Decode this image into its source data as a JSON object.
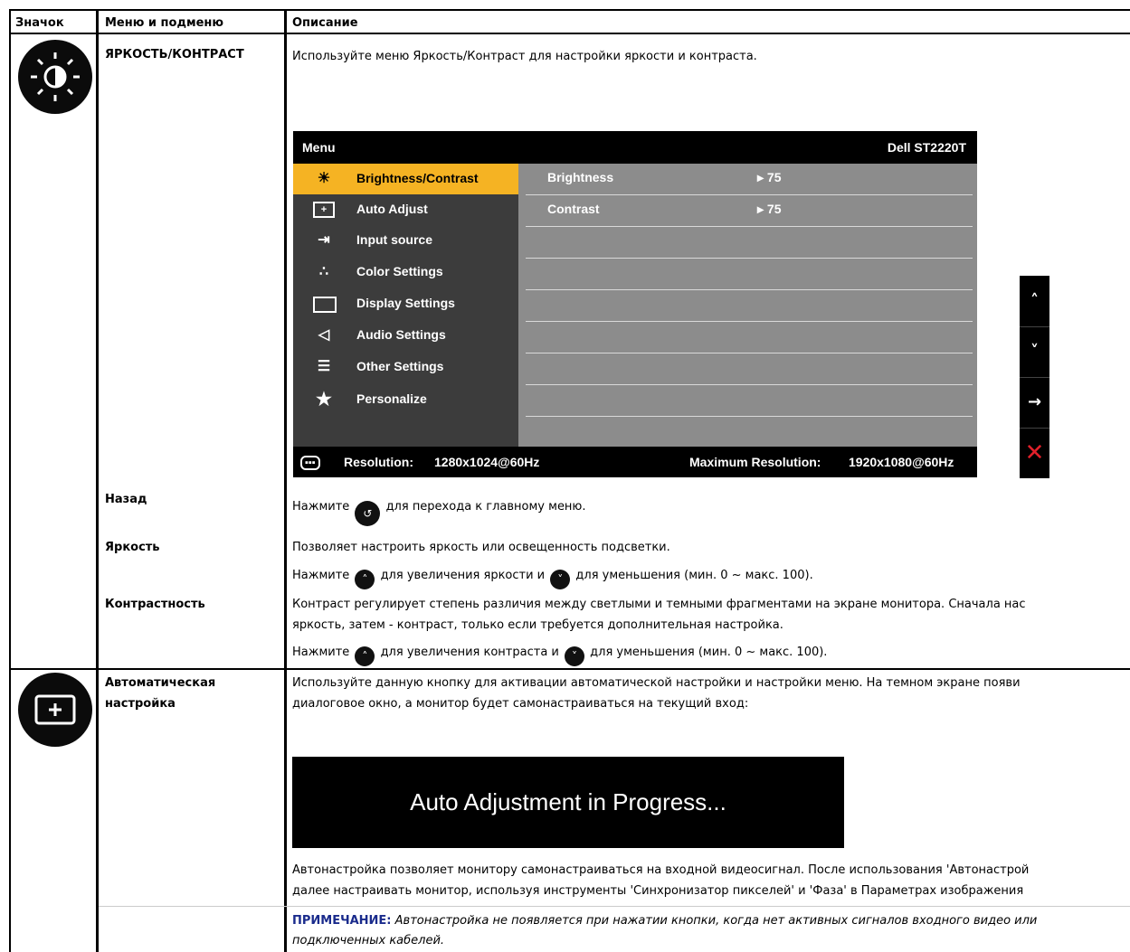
{
  "headers": {
    "icon": "Значок",
    "menu": "Меню и подменю",
    "desc": "Описание"
  },
  "section1": {
    "icon": "brightness-contrast-icon",
    "menu": "ЯРКОСТЬ/КОНТРАСТ",
    "desc": "Используйте меню Яркость/Контраст для настройки яркости и контраста."
  },
  "osd": {
    "title": "Menu",
    "model": "Dell ST2220T",
    "items": [
      {
        "label": "Brightness/Contrast",
        "icon": "brightness-icon"
      },
      {
        "label": "Auto Adjust",
        "icon": "auto-adjust-icon"
      },
      {
        "label": "Input source",
        "icon": "input-source-icon"
      },
      {
        "label": "Color Settings",
        "icon": "color-settings-icon"
      },
      {
        "label": "Display Settings",
        "icon": "display-settings-icon"
      },
      {
        "label": "Audio Settings",
        "icon": "speaker-icon"
      },
      {
        "label": "Other Settings",
        "icon": "other-settings-icon"
      },
      {
        "label": "Personalize",
        "icon": "star-icon"
      }
    ],
    "sub": [
      {
        "name": "Brightness",
        "value": "75"
      },
      {
        "name": "Contrast",
        "value": "75"
      }
    ],
    "resolution_label": "Resolution:",
    "resolution": "1280x1024@60Hz",
    "max_label": "Maximum Resolution:",
    "max": "1920x1080@60Hz"
  },
  "back": {
    "menu": "Назад",
    "pre": "Нажмите",
    "post": "для перехода к главному меню."
  },
  "brightness": {
    "menu": "Яркость",
    "line1": "Позволяет настроить яркость или освещенность подсветки.",
    "pre": "Нажмите",
    "mid": "для увеличения яркости и",
    "post": "для уменьшения (мин. 0 ~ макс. 100)."
  },
  "contrast": {
    "menu": "Контрастность",
    "line1": "Контраст регулирует степень различия между светлыми и темными фрагментами на экране монитора. Сначала нас",
    "line2": "яркость, затем - контраст, только если требуется дополнительная настройка.",
    "pre": "Нажмите",
    "mid": "для увеличения контраста и",
    "post": "для уменьшения (мин. 0 ~ макс. 100)."
  },
  "auto": {
    "menu1": "Автоматическая",
    "menu2": "настройка",
    "line1": "Используйте данную кнопку для активации автоматической настройки и настройки меню. На темном экране появи",
    "line2": "диалоговое окно, а монитор будет самонастраиваться на текущий вход:",
    "banner": "Auto Adjustment in Progress...",
    "line3": "Автонастройка позволяет монитору самонастраиваться на входной видеосигнал. После использования 'Автонастрой",
    "line4": "далее настраивать монитор, используя инструменты 'Синхронизатор пикселей' и 'Фаза' в Параметрах изображения",
    "note_label": "ПРИМЕЧАНИЕ:",
    "note1": "Автонастройка не появляется при нажатии кнопки, когда нет активных сигналов входного видео или",
    "note2": "подключенных кабелей."
  }
}
